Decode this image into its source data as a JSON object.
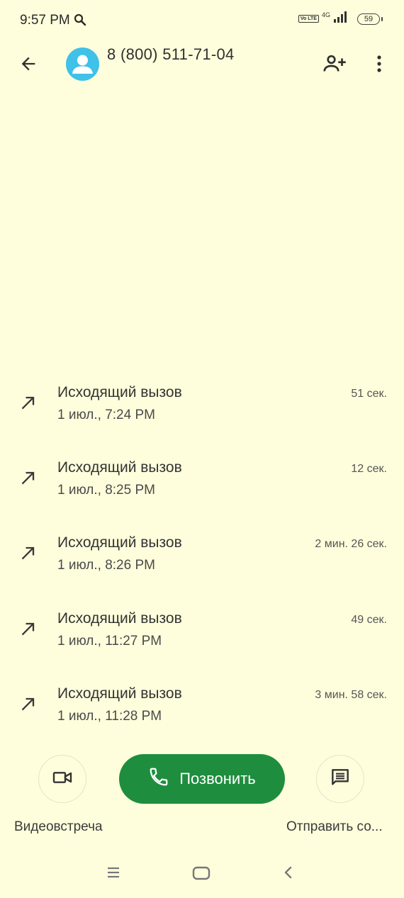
{
  "status_bar": {
    "time": "9:57 PM",
    "volte": "Vo LTE",
    "network_type": "4G",
    "battery": "59"
  },
  "app_bar": {
    "contact_name": "8 (800) 511-71-04"
  },
  "calls": [
    {
      "title": "Исходящий вызов",
      "time": "1 июл., 7:24 PM",
      "duration": "51 сек."
    },
    {
      "title": "Исходящий вызов",
      "time": "1 июл., 8:25 PM",
      "duration": "12 сек."
    },
    {
      "title": "Исходящий вызов",
      "time": "1 июл., 8:26 PM",
      "duration": "2 мин. 26 сек."
    },
    {
      "title": "Исходящий вызов",
      "time": "1 июл., 11:27 PM",
      "duration": "49 сек."
    },
    {
      "title": "Исходящий вызов",
      "time": "1 июл., 11:28 PM",
      "duration": "3 мин. 58 сек."
    }
  ],
  "actions": {
    "video_label": "Видеовстреча",
    "call_label": "Позвонить",
    "message_label": "Отправить со..."
  },
  "icons": {
    "back": "arrow-left-icon",
    "add_contact": "person-add-icon",
    "more": "more-vert-icon",
    "call_type": "outgoing-call-icon",
    "video": "videocam-icon",
    "phone": "phone-icon",
    "message": "message-icon"
  },
  "colors": {
    "background": "#FFFEDC",
    "avatar": "#3FC1E8",
    "call_button": "#1E8E3E"
  }
}
